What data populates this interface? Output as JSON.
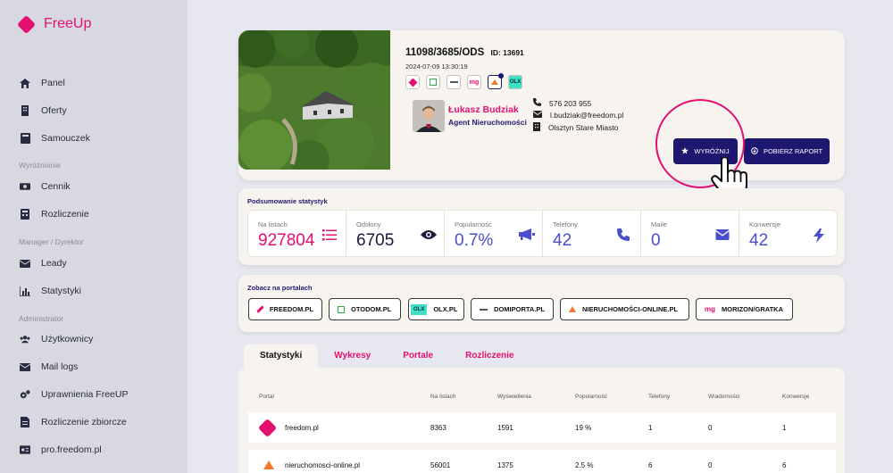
{
  "brand": {
    "name": "FreeUp"
  },
  "sidebar": {
    "items": [
      {
        "label": "Panel",
        "icon": "home-icon"
      },
      {
        "label": "Oferty",
        "icon": "building-icon"
      },
      {
        "label": "Samouczek",
        "icon": "book-icon"
      },
      {
        "label": "Cennik",
        "icon": "money-icon"
      },
      {
        "label": "Rozliczenie",
        "icon": "calculator-icon"
      },
      {
        "label": "Leady",
        "icon": "mail-icon"
      },
      {
        "label": "Statystyki",
        "icon": "chart-icon"
      },
      {
        "label": "Użytkownicy",
        "icon": "users-icon"
      },
      {
        "label": "Mail logs",
        "icon": "mail-icon"
      },
      {
        "label": "Uprawnienia FreeUP",
        "icon": "cogs-icon"
      },
      {
        "label": "Rozliczenie zbiorcze",
        "icon": "file-invoice-icon"
      },
      {
        "label": "pro.freedom.pl",
        "icon": "id-card-icon"
      }
    ],
    "sections": [
      "Wyróżnianie",
      "Manager / Dyrektor",
      "Administrator"
    ]
  },
  "offer": {
    "code": "11098/3685/ODS",
    "id_label": "ID: 13691",
    "date": "2024-07-09 13:30:19"
  },
  "agent": {
    "name": "Łukasz Budziak",
    "role": "Agent Nieruchomości",
    "phone": "576 203 955",
    "email": "l.budziak@freedom.pl",
    "office": "Olsztyn Stare Miasto"
  },
  "actions": {
    "highlight": "WYRÓŻNIJ",
    "report": "POBIERZ RAPORT"
  },
  "stats": {
    "heading": "Podsumowanie statystyk",
    "items": [
      {
        "label": "Na listach",
        "value": "927804",
        "color": "#e3106f",
        "icon": "list-icon"
      },
      {
        "label": "Odsłony",
        "value": "6705",
        "color": "#1c1c3a",
        "icon": "eye-icon"
      },
      {
        "label": "Popularność",
        "value": "0.7%",
        "color": "#4a4ed1",
        "icon": "megaphone-icon"
      },
      {
        "label": "Telefony",
        "value": "42",
        "color": "#4a4ed1",
        "icon": "phone-icon"
      },
      {
        "label": "Maile",
        "value": "0",
        "color": "#4a4ed1",
        "icon": "envelope-icon"
      },
      {
        "label": "Konwersje",
        "value": "42",
        "color": "#4a4ed1",
        "icon": "bolt-icon"
      }
    ]
  },
  "portals": {
    "heading": "Zobacz na portalach",
    "items": [
      {
        "label": "FREEDOM.PL"
      },
      {
        "label": "OTODOM.PL"
      },
      {
        "label": "OLX.PL"
      },
      {
        "label": "DOMIPORTA.PL"
      },
      {
        "label": "NIERUCHOMOŚCI-ONLINE.PL"
      },
      {
        "label": "MORIZON/GRATKA"
      }
    ]
  },
  "tabs": [
    "Statystyki",
    "Wykresy",
    "Portale",
    "Rozliczenie"
  ],
  "table": {
    "headers": [
      "Portal",
      "Na listach",
      "Wyświetlenia",
      "Popularność",
      "Telefony",
      "Wiadomości",
      "Konwersje"
    ],
    "rows": [
      [
        "freedom.pl",
        "8363",
        "1591",
        "19 %",
        "1",
        "0",
        "1"
      ],
      [
        "nieruchomosci-online.pl",
        "56001",
        "1375",
        "2.5 %",
        "6",
        "0",
        "6"
      ]
    ]
  }
}
